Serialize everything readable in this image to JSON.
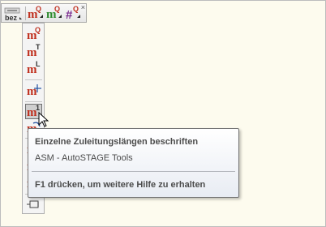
{
  "colors": {
    "background": "#fdfbee",
    "icon_red": "#c0301f",
    "icon_green": "#2e8b2e",
    "icon_purple": "#7a2b8f",
    "tooltip_text": "#4c4c4c"
  },
  "horizontal_toolbar": {
    "label_button": {
      "line1": "",
      "line2": "bez"
    },
    "buttons": [
      {
        "letter": "m",
        "sup": "Q",
        "color": "red"
      },
      {
        "letter": "m",
        "sup": "Q",
        "color": "green"
      },
      {
        "letter": "#",
        "sup": "Q",
        "color": "purple"
      }
    ],
    "close_glyph": "×"
  },
  "vertical_toolbar": {
    "buttons": [
      {
        "letter": "m",
        "sup": "Q",
        "name": "vtool-m-q"
      },
      {
        "letter": "m",
        "sup": "T",
        "name": "vtool-m-t"
      },
      {
        "letter": "m",
        "sup": "L",
        "name": "vtool-m-l"
      },
      {
        "letter": "m",
        "sup": "",
        "name": "vtool-m-cross"
      },
      {
        "letter": "m",
        "sup": "1",
        "name": "vtool-m-1",
        "pressed": true
      },
      {
        "letter": "m",
        "sup": "",
        "name": "vtool-m-curve"
      },
      {
        "letter": "m",
        "sup": "",
        "name": "vtool-m-arrow-1"
      },
      {
        "letter": "m",
        "sup": "",
        "name": "vtool-m-arrow-2"
      },
      {
        "letter": "m",
        "sup": "",
        "name": "vtool-m-arrow-3"
      }
    ]
  },
  "tooltip": {
    "title": "Einzelne Zuleitungslängen beschriften",
    "subtitle": "ASM - AutoSTAGE Tools",
    "help": "F1 drücken, um weitere Hilfe zu erhalten"
  }
}
